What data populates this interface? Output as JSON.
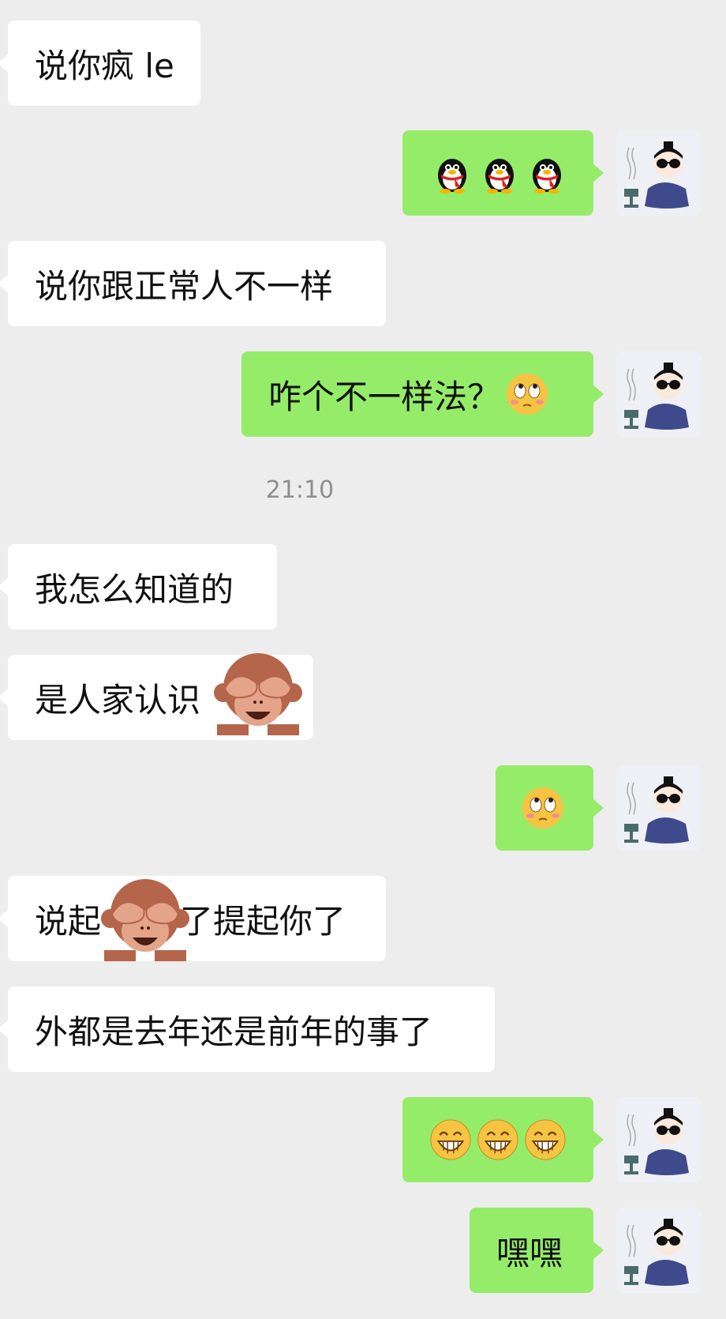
{
  "messages": [
    {
      "side": "left",
      "text": "说你疯 le"
    },
    {
      "side": "right",
      "emoji": [
        "qq-penguin-icon",
        "qq-penguin-icon",
        "qq-penguin-icon"
      ]
    },
    {
      "side": "left",
      "text": "说你跟正常人不一样"
    },
    {
      "side": "right",
      "text": "咋个不一样法？",
      "emoji": [
        "eye-roll-face-icon"
      ]
    },
    {
      "side": "left",
      "text": "我怎么知道的"
    },
    {
      "side": "left",
      "text": "是人家认识",
      "emoji": [
        "see-no-evil-monkey-icon"
      ]
    },
    {
      "side": "right",
      "emoji": [
        "eye-roll-face-icon"
      ]
    },
    {
      "side": "left",
      "text_a": "说起",
      "text_b": "了提起你了",
      "emoji": [
        "see-no-evil-monkey-icon"
      ]
    },
    {
      "side": "left",
      "text": "外都是去年还是前年的事了"
    },
    {
      "side": "right",
      "emoji": [
        "grin-face-icon",
        "grin-face-icon",
        "grin-face-icon"
      ]
    },
    {
      "side": "right",
      "text": "嘿嘿"
    }
  ],
  "timestamp": "21:10",
  "colors": {
    "background": "#ededed",
    "left_bubble": "#ffffff",
    "right_bubble": "#95ec69",
    "timestamp": "#8e8e8e",
    "avatar_robe": "#3f4a8c",
    "monkey": "#b4654a"
  },
  "avatar": {
    "icon": "monk-with-sunglasses-avatar-icon"
  }
}
